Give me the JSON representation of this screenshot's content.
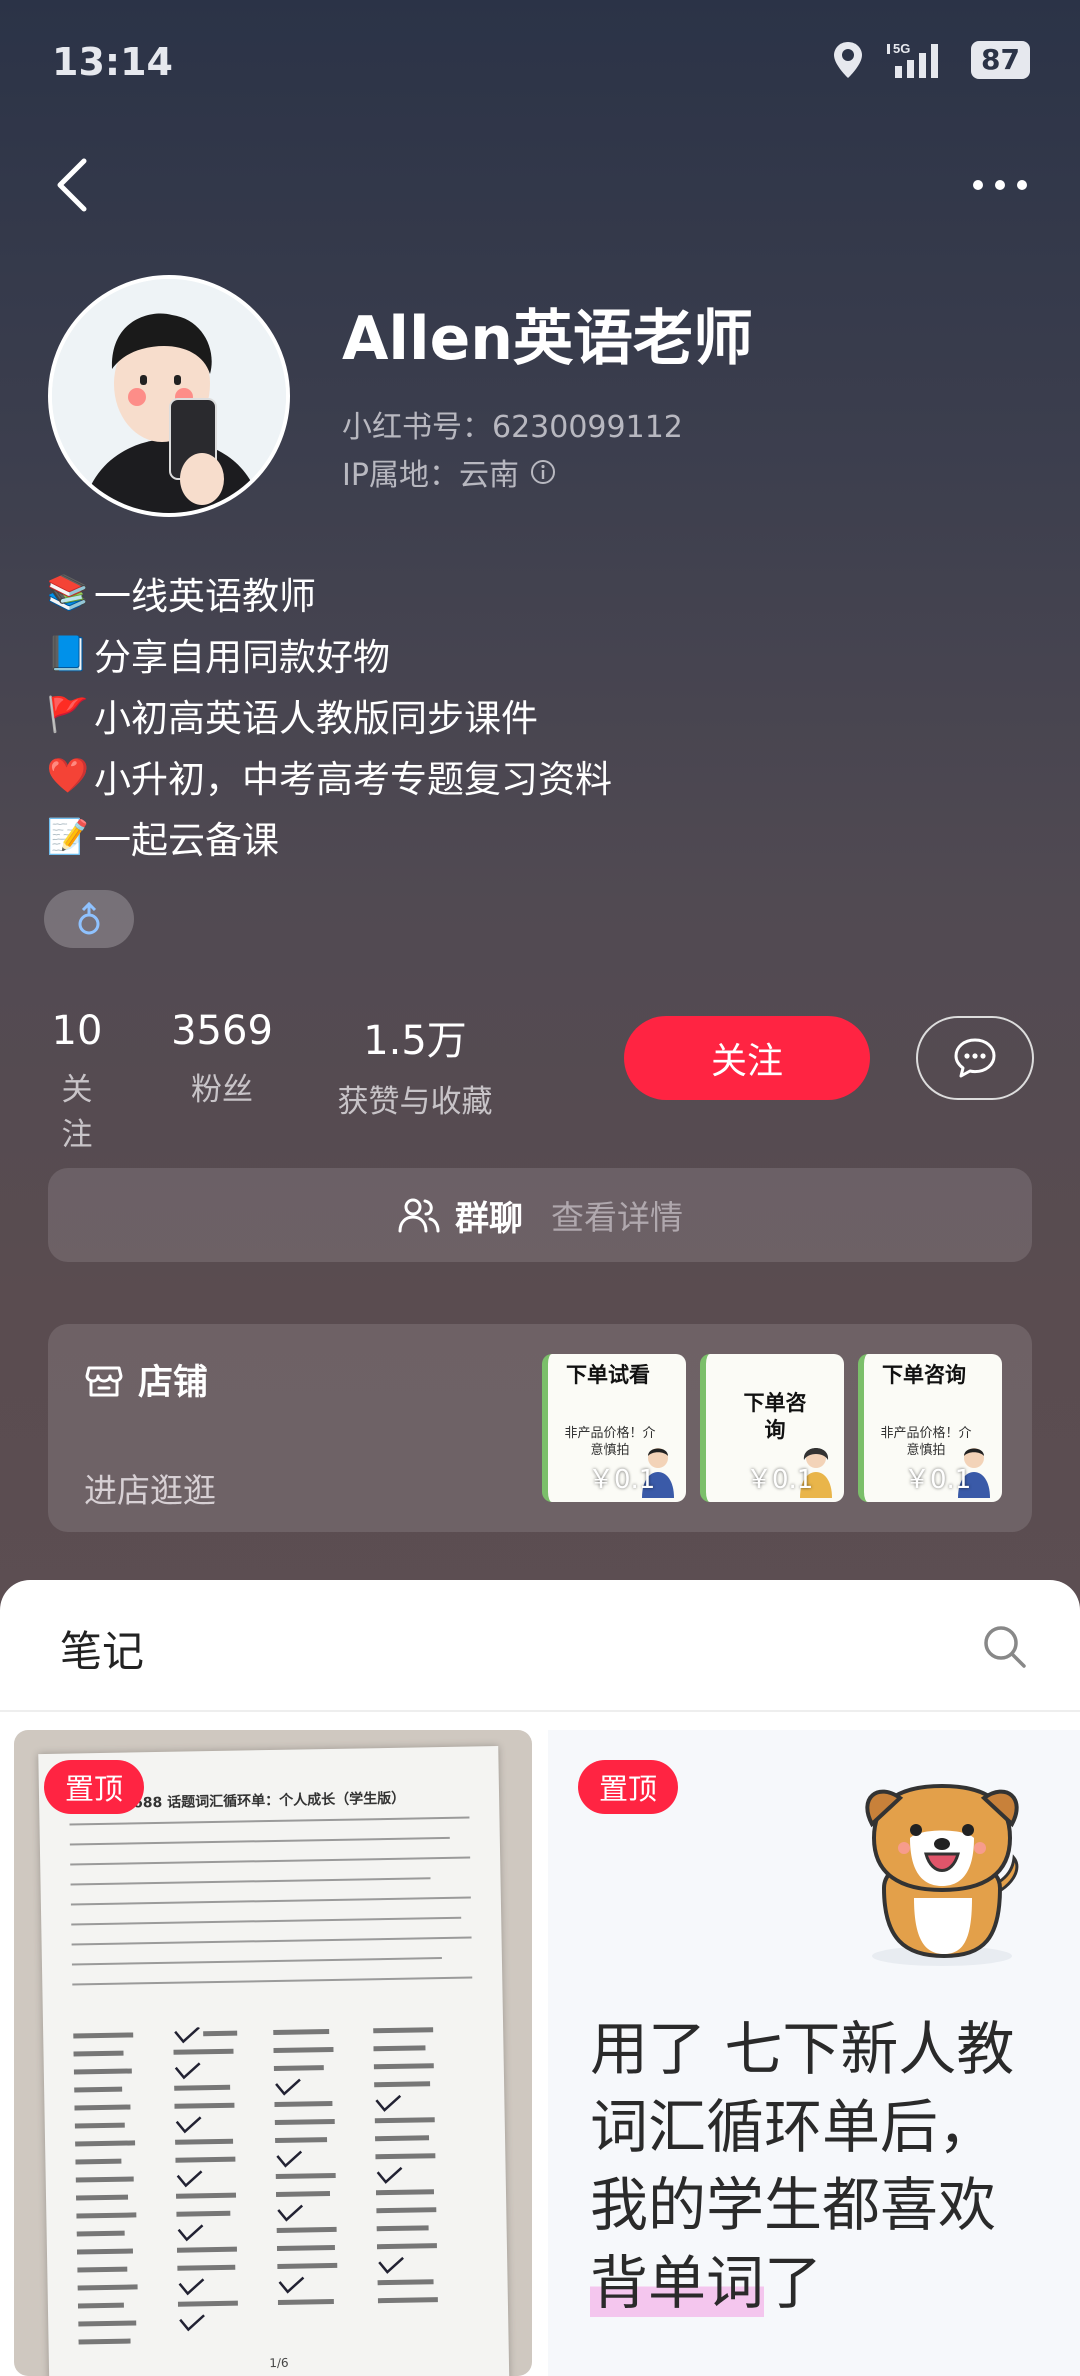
{
  "status": {
    "time": "13:14",
    "battery": "87",
    "network": "5G"
  },
  "profile": {
    "name": "Allen英语老师",
    "red_id": "小红书号：6230099112",
    "ip": "IP属地：云南"
  },
  "bio": [
    {
      "emoji": "📚",
      "text": "一线英语教师"
    },
    {
      "emoji": "📘",
      "text": "分享自用同款好物"
    },
    {
      "emoji": "🚩",
      "text": "小初高英语人教版同步课件"
    },
    {
      "emoji": "❤️",
      "text": "小升初，中考高考专题复习资料"
    },
    {
      "emoji": "📝",
      "text": "一起云备课"
    }
  ],
  "stats": [
    {
      "num": "10",
      "label": "关注"
    },
    {
      "num": "3569",
      "label": "粉丝"
    },
    {
      "num": "1.5万",
      "label": "获赞与收藏"
    }
  ],
  "actions": {
    "follow": "关注"
  },
  "group": {
    "title": "群聊",
    "detail": "查看详情"
  },
  "shop": {
    "title": "店铺",
    "enter": "进店逛逛",
    "items": [
      {
        "title": "下单试看",
        "sub": "非产品价格！介意慎拍",
        "price": "￥0.1"
      },
      {
        "title": "下单咨询",
        "sub": "",
        "price": "￥0.1"
      },
      {
        "title": "下单咨询",
        "sub": "非产品价格！介意慎拍",
        "price": "￥0.1"
      }
    ]
  },
  "notes": {
    "tab": "笔记",
    "cards": [
      {
        "pin": "置顶",
        "paper_title": "688 话题词汇循环单：个人成长（学生版）",
        "paper_page": "1/6"
      },
      {
        "pin": "置顶",
        "text_a": "用了 七下新人教词汇循环单后，我的学生都喜欢",
        "text_hl": "背单词",
        "text_b": "了"
      }
    ]
  },
  "colors": {
    "accent": "#ff2442",
    "bg_top": "#2b3347",
    "bg_bottom": "#5c4e52"
  }
}
